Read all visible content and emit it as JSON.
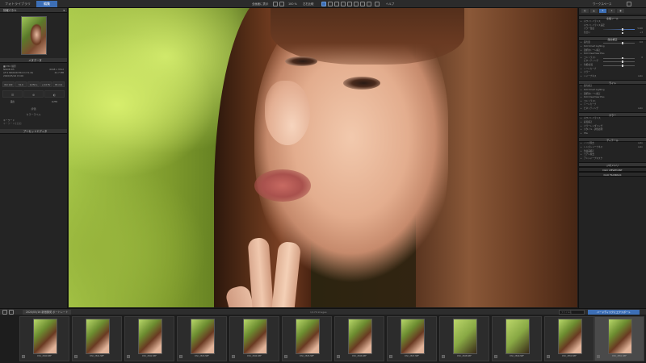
{
  "topbar": {
    "tab_library": "フォトライブラリ",
    "tab_edit": "編集",
    "view_toggle": "全画面に表示",
    "zoom_label": "100 %",
    "compare_label": "左右比較",
    "workspace_label": "ワークスペース",
    "help_label": "ヘルプ"
  },
  "left_panel": {
    "nav_header": "情報パネル",
    "meta_header": "メタデータ",
    "meta": [
      {
        "k": "■ DSC 撮影",
        "v": ""
      },
      {
        "k": "NIKON D5",
        "v": "6048 x 3512"
      },
      {
        "k": "AF-S NIKKOR 85mm f/1.4G",
        "v": "42.7 MB"
      },
      {
        "k": "2020/05/16 15:06",
        "v": ""
      }
    ],
    "exif_btns": [
      "ISO 100",
      "f/1.6",
      "1/250 s",
      "+0.0 EV",
      "85 mm"
    ],
    "icons": [
      "☰",
      "⊕",
      "◐"
    ],
    "icon_labels": [
      "露出",
      "",
      "AUTO"
    ],
    "rating_label": "評価",
    "color_label": "カラーラベル",
    "keyword_label": "キーワード",
    "keyword_placeholder": "キーワードを追加",
    "preset_header": "プリセットエディタ"
  },
  "right_panel": {
    "tabs": [
      "◐",
      "▲",
      "✦",
      "★",
      "●"
    ],
    "sections": [
      {
        "title": "全般ツール",
        "rows": [
          {
            "label": "ホワイトバランス",
            "val": ""
          },
          {
            "label": "ホワイトバランス設定",
            "val": ""
          },
          {
            "label": "カラー温度",
            "val": "5400"
          },
          {
            "label": "色合い",
            "val": "+3"
          }
        ]
      },
      {
        "title": "露出補正",
        "rows": [
          {
            "label": "露光量",
            "val": "0.0"
          },
          {
            "label": "DxO Smart Lighting",
            "val": ""
          },
          {
            "label": "選択的トーン補正",
            "val": ""
          },
          {
            "label": "DxO ClearView Plus",
            "val": ""
          },
          {
            "label": "コントラスト",
            "val": "0"
          },
          {
            "label": "ビネッティング",
            "val": ""
          },
          {
            "label": "色相/彩度",
            "val": ""
          },
          {
            "label": "トーンカーブ",
            "val": ""
          },
          {
            "label": "カラー",
            "val": ""
          },
          {
            "label": "シャープネス",
            "val": "Auto"
          }
        ]
      },
      {
        "title": "ライト",
        "rows": [
          {
            "label": "露光補正",
            "val": ""
          },
          {
            "label": "DxO Smart Lighting",
            "val": ""
          },
          {
            "label": "選択的トーン補正",
            "val": ""
          },
          {
            "label": "DxO ClearView Plus",
            "val": ""
          },
          {
            "label": "コントラスト",
            "val": ""
          },
          {
            "label": "トーンカーブ",
            "val": ""
          },
          {
            "label": "ビネッティング",
            "val": "Auto"
          }
        ]
      },
      {
        "title": "カラー",
        "rows": [
          {
            "label": "ホワイトバランス",
            "val": ""
          },
          {
            "label": "彩度補正",
            "val": ""
          },
          {
            "label": "カラーレンダリング",
            "val": ""
          },
          {
            "label": "スタイル - 調色処理",
            "val": ""
          },
          {
            "label": "HSL",
            "val": ""
          }
        ]
      },
      {
        "title": "ディテール",
        "rows": [
          {
            "label": "ノイズ除去",
            "val": "Auto"
          },
          {
            "label": "レンズシャープネス",
            "val": "Auto"
          },
          {
            "label": "色収差補正",
            "val": ""
          },
          {
            "label": "モアレ除去",
            "val": ""
          },
          {
            "label": "アンシャープマスク",
            "val": ""
          }
        ]
      },
      {
        "title": "ジオメトリ",
        "rows": [
          {
            "label": "DxO VIEWPOINT",
            "val": ""
          },
          {
            "label": "DxO FILMPACK",
            "val": ""
          }
        ]
      }
    ]
  },
  "filmbar": {
    "folder": "2020/05/16 新宿御苑 ポートレート",
    "count": "1/170 images",
    "search_placeholder": "ファイル名",
    "export_label": "ハードディスクにエクスポート"
  },
  "filmstrip": [
    {
      "name": "DSC_2840.NEF",
      "kind": "a"
    },
    {
      "name": "DSC_2841.NEF",
      "kind": "a"
    },
    {
      "name": "DSC_2842.NEF",
      "kind": "a"
    },
    {
      "name": "DSC_2843.NEF",
      "kind": "a"
    },
    {
      "name": "DSC_2844.NEF",
      "kind": "a"
    },
    {
      "name": "DSC_2845.NEF",
      "kind": "a"
    },
    {
      "name": "DSC_2846.NEF",
      "kind": "a"
    },
    {
      "name": "DSC_2847.NEF",
      "kind": "a"
    },
    {
      "name": "DSC_2848.NEF",
      "kind": "b"
    },
    {
      "name": "DSC_2849.NEF",
      "kind": "b"
    },
    {
      "name": "DSC_2850.NEF",
      "kind": "a"
    },
    {
      "name": "DSC_2851.NEF",
      "kind": "a"
    }
  ]
}
